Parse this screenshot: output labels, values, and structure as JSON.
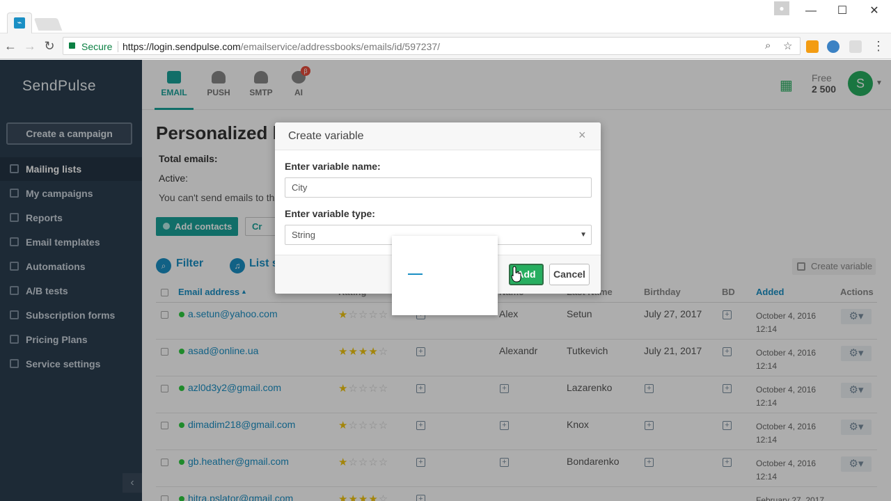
{
  "browser": {
    "url_host": "https://login.sendpulse.com",
    "url_path": "/emailservice/addressbooks/emails/id/597237/",
    "secure_label": "Secure",
    "tab_favicon": "pulse-icon"
  },
  "app": {
    "logo": "SendPulse",
    "create_campaign": "Create a campaign",
    "sidebar": [
      {
        "label": "Mailing lists",
        "active": true
      },
      {
        "label": "My campaigns"
      },
      {
        "label": "Reports"
      },
      {
        "label": "Email templates"
      },
      {
        "label": "Automations"
      },
      {
        "label": "A/B tests"
      },
      {
        "label": "Subscription forms"
      },
      {
        "label": "Pricing Plans"
      },
      {
        "label": "Service settings"
      }
    ],
    "services": [
      {
        "label": "EMAIL",
        "icon": "envelope-icon",
        "active": true
      },
      {
        "label": "PUSH",
        "icon": "bell-icon"
      },
      {
        "label": "SMTP",
        "icon": "cloud-icon"
      },
      {
        "label": "AI",
        "icon": "brain-icon"
      }
    ],
    "beta_badge": "β",
    "plan_label": "Free",
    "plan_value": "2 500",
    "avatar_letter": "S"
  },
  "page": {
    "title": "Personalized l",
    "total_emails_label": "Total emails:",
    "active_label": "Active:",
    "warning": "You can't send emails to th",
    "add_contacts": "Add contacts",
    "create_partial": "Cr",
    "filter": "Filter",
    "list_settings_partial": "List s",
    "create_variable": "Create variable"
  },
  "table": {
    "headers": {
      "email": "Email address",
      "rating": "Rating",
      "name": "Name",
      "last_name": "Last Name",
      "birthday": "Birthday",
      "bd": "BD",
      "added": "Added",
      "actions": "Actions"
    },
    "rows": [
      {
        "email": "a.setun@yahoo.com",
        "rating": 1,
        "name": "Alex",
        "last_name": "Setun",
        "birthday": "July 27, 2017",
        "added_date": "October 4, 2016",
        "added_time": "12:14"
      },
      {
        "email": "asad@online.ua",
        "rating": 4,
        "name": "Alexandr",
        "last_name": "Tutkevich",
        "birthday": "July 21, 2017",
        "added_date": "October 4, 2016",
        "added_time": "12:14"
      },
      {
        "email": "azl0d3y2@gmail.com",
        "rating": 1,
        "name": "",
        "last_name": "Lazarenko",
        "birthday": "",
        "added_date": "October 4, 2016",
        "added_time": "12:14"
      },
      {
        "email": "dimadim218@gmail.com",
        "rating": 1,
        "name": "",
        "last_name": "Knox",
        "birthday": "",
        "added_date": "October 4, 2016",
        "added_time": "12:14"
      },
      {
        "email": "gb.heather@gmail.com",
        "rating": 1,
        "name": "",
        "last_name": "Bondarenko",
        "birthday": "",
        "added_date": "October 4, 2016",
        "added_time": "12:14"
      },
      {
        "email": "hitra.pslator@gmail.com",
        "rating": 4,
        "name": "",
        "last_name": "",
        "birthday": "",
        "added_date": "February 27, 2017",
        "added_time": ""
      }
    ]
  },
  "modal": {
    "title": "Create variable",
    "name_label": "Enter variable name:",
    "name_value": "City",
    "type_label": "Enter variable type:",
    "type_value": "String",
    "add_button": "Add",
    "cancel_button": "Cancel"
  },
  "colors": {
    "accent": "#1aa39a",
    "link": "#1a8fc4",
    "sidebar_bg": "#2c3e50",
    "add_button": "#27ae60"
  }
}
